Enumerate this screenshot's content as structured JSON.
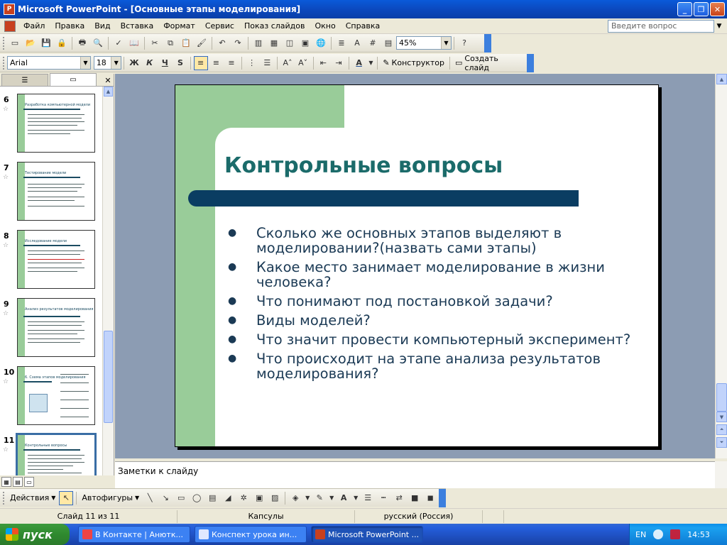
{
  "window": {
    "title": "Microsoft PowerPoint - [Основные этапы моделирования]",
    "app_icon": "powerpoint-icon"
  },
  "menu": {
    "items": [
      "Файл",
      "Правка",
      "Вид",
      "Вставка",
      "Формат",
      "Сервис",
      "Показ слайдов",
      "Окно",
      "Справка"
    ],
    "help_placeholder": "Введите вопрос"
  },
  "toolbar_standard": {
    "zoom": "45%"
  },
  "toolbar_formatting": {
    "font": "Arial",
    "size": "18",
    "bold": "Ж",
    "italic": "К",
    "underline": "Ч",
    "shadow": "S",
    "designer": "Конструктор",
    "new_slide": "Создать слайд"
  },
  "left_panel": {
    "thumbnails": [
      {
        "num": "6",
        "title": "Разработка компьютерной модели"
      },
      {
        "num": "7",
        "title": "Тестирование модели"
      },
      {
        "num": "8",
        "title": "Исследование модели"
      },
      {
        "num": "9",
        "title": "Анализ результатов моделирования"
      },
      {
        "num": "10",
        "title": "6. Схема этапов моделирования"
      },
      {
        "num": "11",
        "title": "Контрольные вопросы"
      }
    ]
  },
  "slide": {
    "title": "Контрольные вопросы",
    "bullets": [
      "Сколько же основных этапов выделяют в моделировании?(назвать сами этапы)",
      "Какое место занимает моделирование в жизни человека?",
      "Что понимают под постановкой задачи?",
      "Виды моделей?",
      "Что значит провести компьютерный эксперимент?",
      "Что происходит на этапе анализа результатов моделирования?"
    ]
  },
  "notes": {
    "placeholder": "Заметки к слайду"
  },
  "drawing_toolbar": {
    "actions": "Действия",
    "autoshapes": "Автофигуры"
  },
  "status": {
    "slide": "Слайд 11 из 11",
    "design": "Капсулы",
    "language": "русский (Россия)"
  },
  "taskbar": {
    "start": "пуск",
    "tasks": [
      "В Контакте | Анютк...",
      "Конспект урока ин...",
      "Microsoft PowerPoint ..."
    ],
    "lang": "EN",
    "clock": "14:53"
  },
  "colors": {
    "slide_green": "#99cc99",
    "slide_title": "#1b6b6a",
    "slide_bar": "#0a3d62",
    "xp_blue": "#0b49bf"
  }
}
